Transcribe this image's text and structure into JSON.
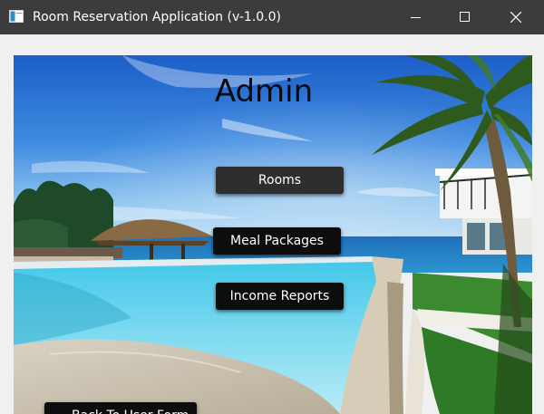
{
  "window": {
    "title": "Room Reservation Application (v-1.0.0)",
    "icon": "app-window-icon",
    "controls": [
      "minimize-icon",
      "maximize-icon",
      "close-icon"
    ]
  },
  "main": {
    "heading": "Admin",
    "background": "resort-pool-photo",
    "buttons": {
      "rooms": "Rooms",
      "meal_packages": "Meal Packages",
      "income_reports": "Income Reports",
      "back": "Back To User Form"
    }
  },
  "colors": {
    "titlebar": "#3c3c3c",
    "button": "#0d0d0d",
    "button_hover": "#2e2e2e",
    "button_text": "#ffffff"
  }
}
